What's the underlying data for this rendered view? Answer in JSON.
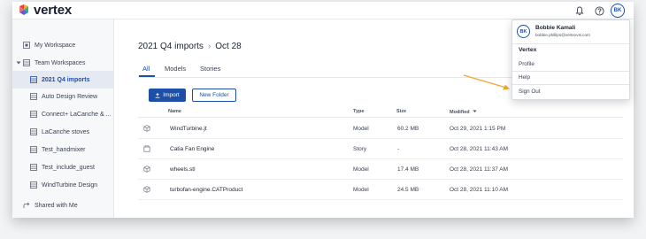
{
  "app": {
    "brand": "vertex"
  },
  "user": {
    "initials": "BK",
    "name": "Bobbie Kamali",
    "email": "bobbie.phillips@vertexvis.com"
  },
  "profile_menu": {
    "org": "Vertex",
    "items": [
      "Profile",
      "Help",
      "Sign Out"
    ]
  },
  "sidebar": {
    "items": [
      {
        "label": "My Workspace",
        "icon": "workspace-icon"
      },
      {
        "label": "Team Workspaces",
        "icon": "team-icon"
      },
      {
        "label": "2021 Q4 imports",
        "icon": "folder-grid-icon"
      },
      {
        "label": "Auto Design Review",
        "icon": "folder-grid-icon"
      },
      {
        "label": "Connect+ LaCanche & ...",
        "icon": "folder-grid-icon"
      },
      {
        "label": "LaCanche stoves",
        "icon": "folder-grid-icon"
      },
      {
        "label": "Test_handmixer",
        "icon": "folder-grid-icon"
      },
      {
        "label": "Test_include_guest",
        "icon": "folder-grid-icon"
      },
      {
        "label": "WindTurbine Design",
        "icon": "folder-grid-icon"
      },
      {
        "label": "Shared with Me",
        "icon": "share-icon"
      }
    ]
  },
  "breadcrumb": {
    "parent": "2021 Q4 imports",
    "current": "Oct 28"
  },
  "tabs": [
    "All",
    "Models",
    "Stories"
  ],
  "actions": {
    "import_label": "Import",
    "new_folder_label": "New Folder"
  },
  "table": {
    "headers": {
      "name": "Name",
      "type": "Type",
      "size": "Size",
      "modified": "Modified"
    },
    "rows": [
      {
        "name": "WindTurbine.jt",
        "type": "Model",
        "size": "60.2 MB",
        "modified": "Oct 29, 2021 1:15 PM",
        "icon": "model-icon"
      },
      {
        "name": "Catia Fan Engine",
        "type": "Story",
        "size": "-",
        "modified": "Oct 28, 2021 11:43 AM",
        "icon": "story-icon"
      },
      {
        "name": "wheels.stl",
        "type": "Model",
        "size": "17.4 MB",
        "modified": "Oct 28, 2021 11:37 AM",
        "icon": "model-icon"
      },
      {
        "name": "turbofan-engine.CATProduct",
        "type": "Model",
        "size": "24.5 MB",
        "modified": "Oct 28, 2021 11:10 AM",
        "icon": "model-icon"
      }
    ]
  },
  "colors": {
    "accent": "#1e4fa6",
    "annotation_arrow": "#f0a830"
  }
}
